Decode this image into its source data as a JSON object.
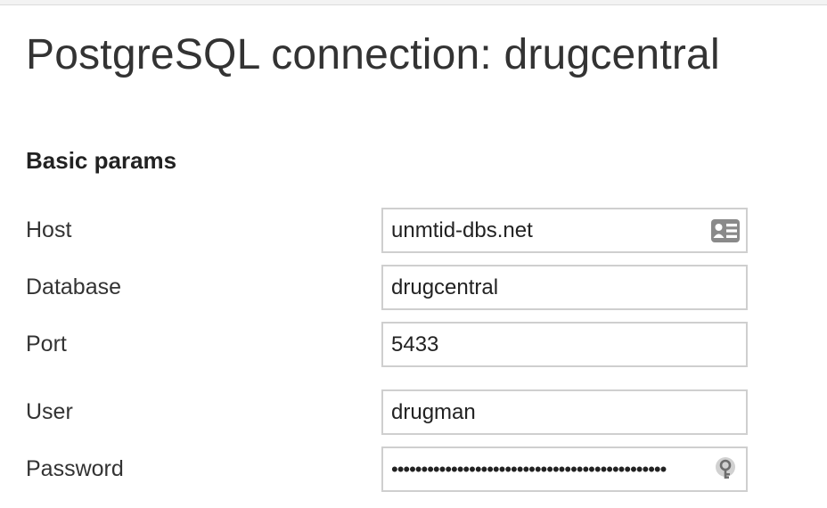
{
  "page": {
    "title": "PostgreSQL connection: drugcentral"
  },
  "section": {
    "title": "Basic params"
  },
  "fields": {
    "host": {
      "label": "Host",
      "value": "unmtid-dbs.net",
      "icon": "contact-card-icon"
    },
    "database": {
      "label": "Database",
      "value": "drugcentral"
    },
    "port": {
      "label": "Port",
      "value": "5433"
    },
    "user": {
      "label": "User",
      "value": "drugman"
    },
    "password": {
      "label": "Password",
      "value": "••••••••••••••••••••••••••••••••••••••••••••••",
      "icon": "password-key-icon"
    }
  }
}
